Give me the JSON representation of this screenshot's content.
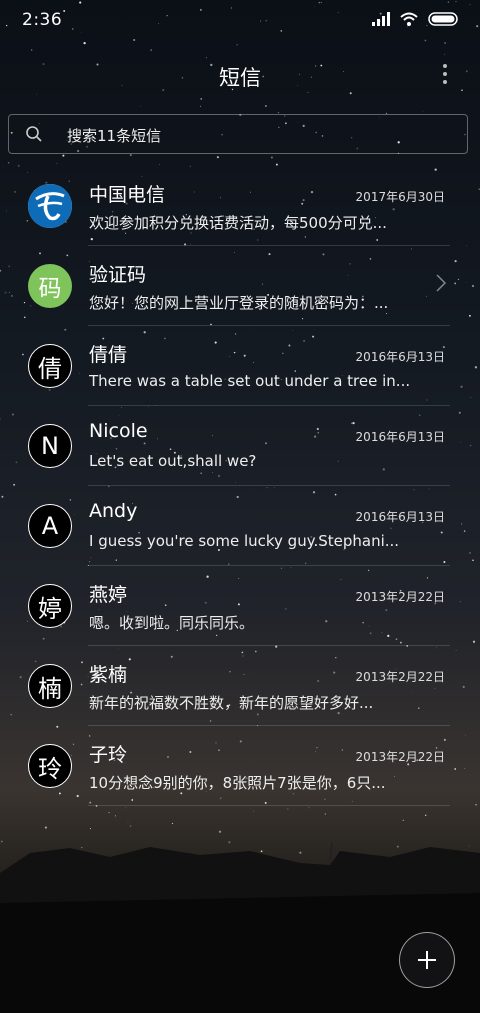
{
  "status_bar": {
    "time": "2:36"
  },
  "header": {
    "title": "短信"
  },
  "search": {
    "placeholder": "搜索11条短信"
  },
  "conversations": [
    {
      "name": "中国电信",
      "date": "2017年6月30日",
      "preview": "欢迎参加积分兑换话费活动，每500分可兑...",
      "avatar": "",
      "avatar_style": "brand"
    },
    {
      "name": "验证码",
      "date": "",
      "preview": "您好！您的网上营业厅登录的随机密码为：...",
      "avatar": "码",
      "avatar_style": "green"
    },
    {
      "name": "倩倩",
      "date": "2016年6月13日",
      "preview": "There was a table set out under a tree in...",
      "avatar": "倩",
      "avatar_style": "dark"
    },
    {
      "name": "Nicole",
      "date": "2016年6月13日",
      "preview": "Let's eat out,shall we?",
      "avatar": "N",
      "avatar_style": "dark"
    },
    {
      "name": "Andy",
      "date": "2016年6月13日",
      "preview": "I guess you're some lucky guy.Stephani...",
      "avatar": "A",
      "avatar_style": "dark"
    },
    {
      "name": "燕婷",
      "date": "2013年2月22日",
      "preview": "嗯。收到啦。同乐同乐。",
      "avatar": "婷",
      "avatar_style": "dark"
    },
    {
      "name": "紫楠",
      "date": "2013年2月22日",
      "preview": "新年的祝福数不胜数，新年的愿望好多好...",
      "avatar": "楠",
      "avatar_style": "dark"
    },
    {
      "name": "子玲",
      "date": "2013年2月22日",
      "preview": "10分想念9别的你，8张照片7张是你，6只...",
      "avatar": "玲",
      "avatar_style": "dark"
    }
  ],
  "icons": {
    "search": "search-icon",
    "more": "more-vertical-icon",
    "compose": "plus-icon",
    "chevron": "chevron-right-icon"
  },
  "colors": {
    "verify_avatar": "#7fc35b",
    "telecom_blue": "#0e6bb8"
  }
}
